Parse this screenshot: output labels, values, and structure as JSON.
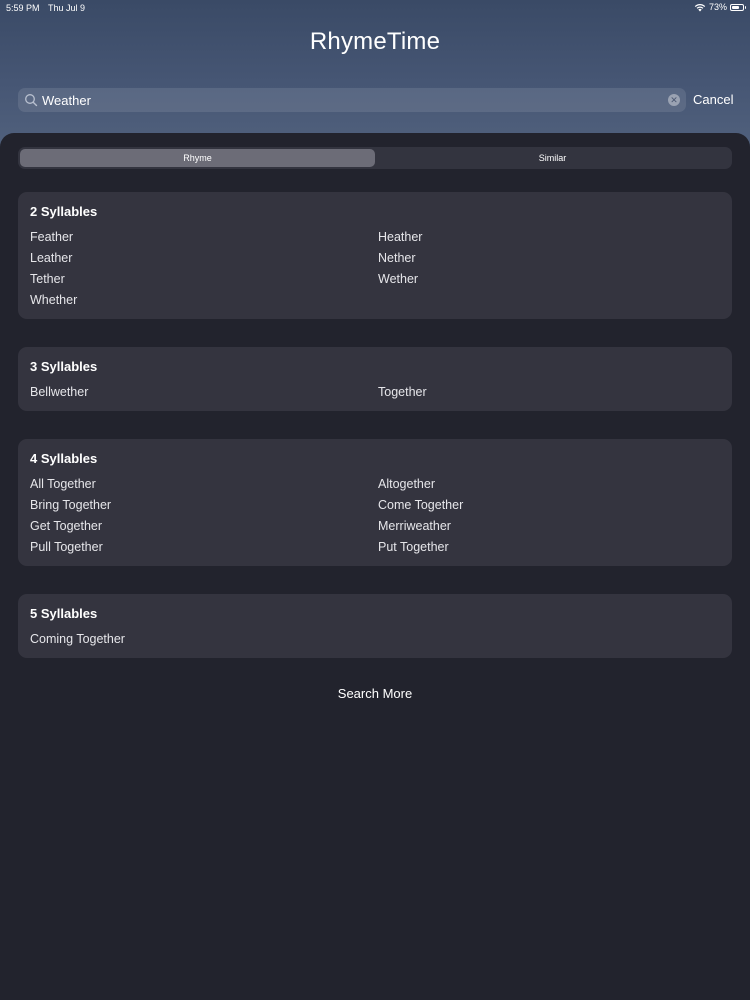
{
  "status_bar": {
    "time": "5:59 PM",
    "date": "Thu Jul 9",
    "battery": "73%",
    "battery_level": 0.73
  },
  "header": {
    "title": "RhymeTime"
  },
  "search": {
    "value": "Weather",
    "cancel_label": "Cancel"
  },
  "segments": [
    {
      "label": "Rhyme",
      "selected": true
    },
    {
      "label": "Similar",
      "selected": false
    }
  ],
  "groups": [
    {
      "title": "2 Syllables",
      "words": [
        "Feather",
        "Heather",
        "Leather",
        "Nether",
        "Tether",
        "Wether",
        "Whether"
      ]
    },
    {
      "title": "3 Syllables",
      "words": [
        "Bellwether",
        "Together"
      ]
    },
    {
      "title": "4 Syllables",
      "words": [
        "All Together",
        "Altogether",
        "Bring Together",
        "Come Together",
        "Get Together",
        "Merriweather",
        "Pull Together",
        "Put Together"
      ]
    },
    {
      "title": "5 Syllables",
      "words": [
        "Coming Together"
      ]
    }
  ],
  "footer": {
    "search_more_label": "Search More"
  }
}
